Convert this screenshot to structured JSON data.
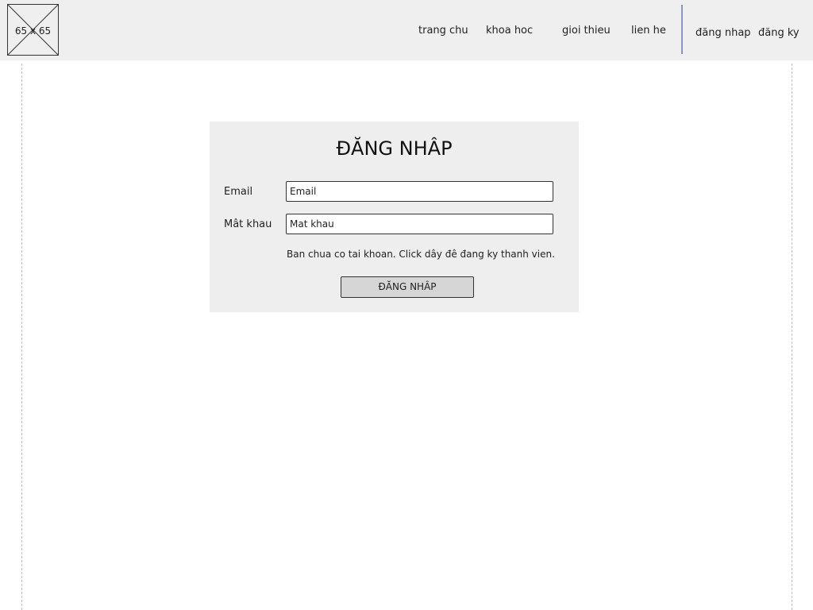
{
  "header": {
    "logo_placeholder": "65 x 65",
    "nav": {
      "home": "trang chu",
      "courses": "khoa hoc",
      "about": "gioi thieu",
      "contact": "lien he",
      "login": "đăng nhap",
      "register": "đăng ky"
    },
    "divider_color": "#8a95c2"
  },
  "login_form": {
    "title": "ĐĂNG NHÂP",
    "email_label": "Email",
    "email_placeholder": "Email",
    "password_label": "Mât khau",
    "password_placeholder": "Mat khau",
    "register_hint": "Ban chua co tai khoan. Click dây đê đang ky thanh vien.",
    "submit_label": "ĐĂNG NHÂP"
  },
  "colors": {
    "header_bg": "#efefef",
    "panel_bg": "#eeeeee",
    "button_bg": "#d6d6d6"
  }
}
